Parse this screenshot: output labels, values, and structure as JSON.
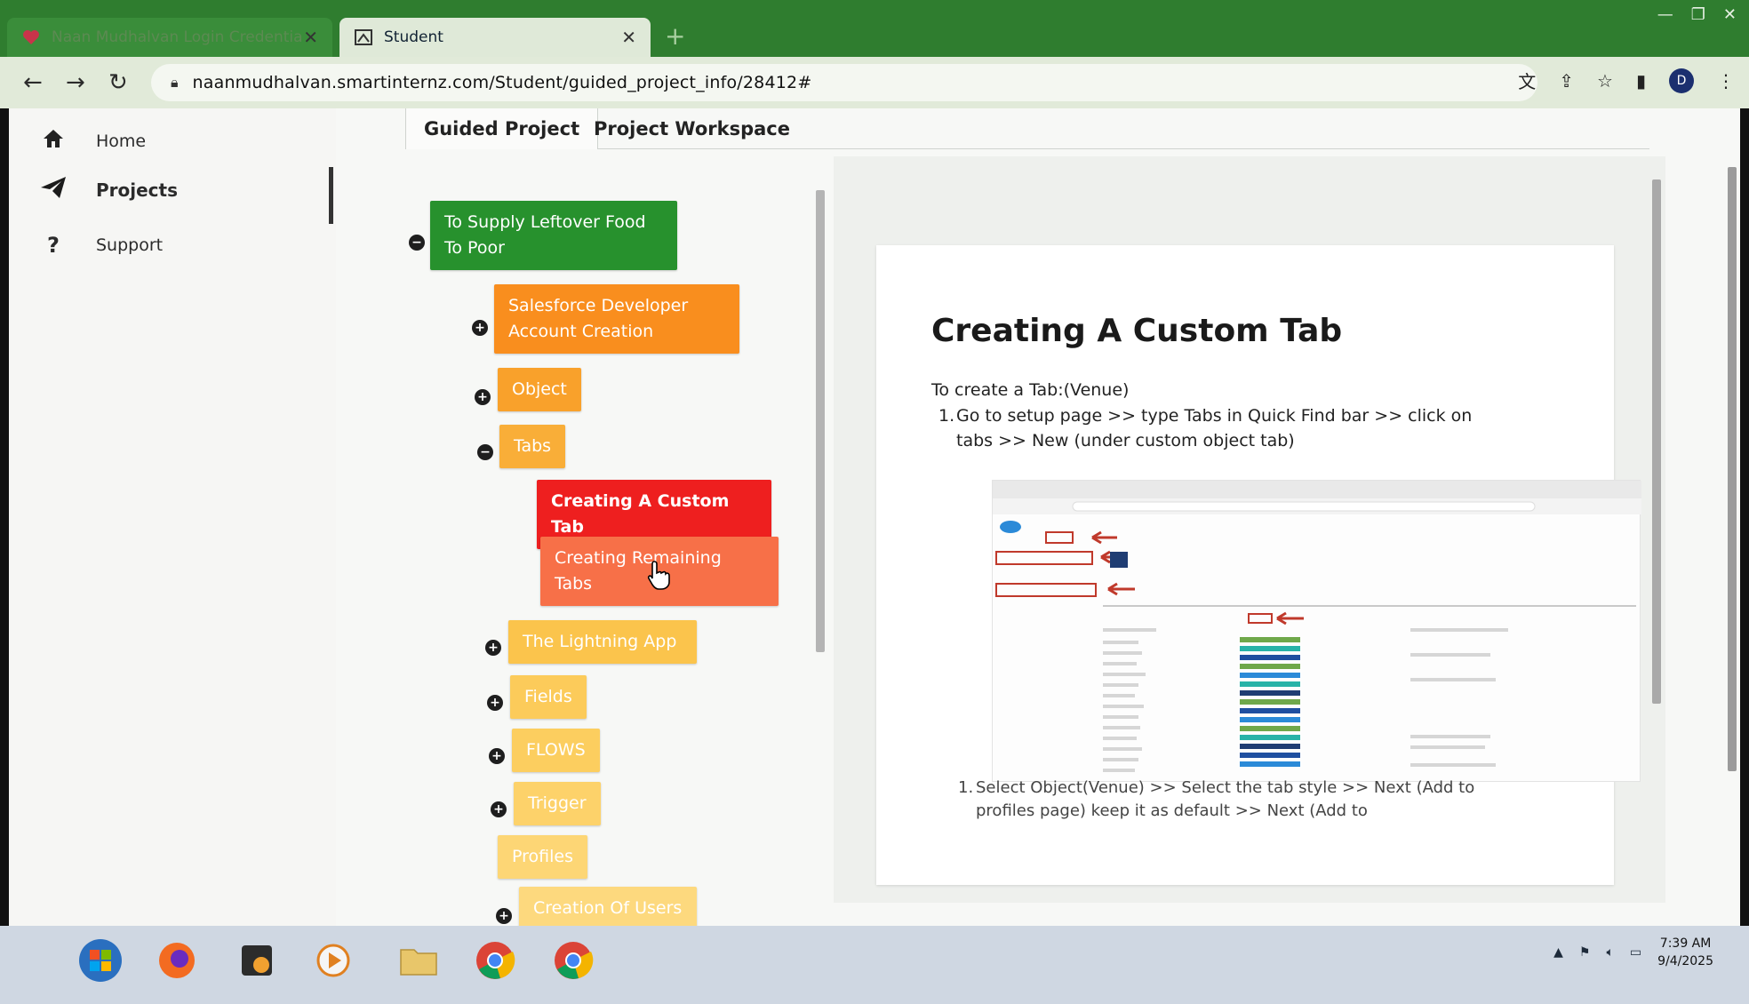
{
  "browser": {
    "tabs": [
      {
        "label": "Naan Mudhalvan Login Credentials - Pass",
        "active": false
      },
      {
        "label": "Student",
        "active": true
      }
    ],
    "url": "naanmudhalvan.smartinternz.com/Student/guided_project_info/28412#",
    "profile_initial": "D"
  },
  "sidebar": {
    "items": [
      {
        "label": "Home",
        "icon": "home-icon"
      },
      {
        "label": "Projects",
        "icon": "paper-plane-icon",
        "active": true
      },
      {
        "label": "Support",
        "icon": "question-icon"
      }
    ]
  },
  "page_tabs": {
    "guided": "Guided Project",
    "workspace": "Project Workspace"
  },
  "tree": {
    "root": {
      "line1": "To Supply Leftover Food",
      "line2": "To Poor",
      "color": "#27912d"
    },
    "n_salesforce": {
      "line1": "Salesforce Developer",
      "line2": "Account Creation",
      "color": "#f98e1e"
    },
    "n_object": {
      "label": "Object",
      "color": "#f9a12b"
    },
    "n_tabs": {
      "label": "Tabs",
      "color": "#f9ae38"
    },
    "n_custom_tab": {
      "label": "Creating A Custom Tab",
      "color": "#ee1f1f"
    },
    "n_remaining": {
      "line1": "Creating Remaining",
      "line2": "Tabs",
      "color": "#f77048"
    },
    "n_lightning": {
      "label": "The Lightning App",
      "color": "#fbc44c"
    },
    "n_fields": {
      "label": "Fields",
      "color": "#fccb5a"
    },
    "n_flows": {
      "label": "FLOWS",
      "color": "#fcce5f"
    },
    "n_trigger": {
      "label": "Trigger",
      "color": "#fdd26a"
    },
    "n_profiles": {
      "label": "Profiles",
      "color": "#fdd675"
    },
    "n_users": {
      "label": "Creation Of Users",
      "color": "#fdd97e"
    }
  },
  "content": {
    "title": "Creating A Custom Tab",
    "intro": "To create a Tab:(Venue)",
    "step1_num": "1.",
    "step1": "Go to setup page >> type Tabs in Quick Find bar >> click on tabs >> New (under custom object tab)",
    "step2_num": "1.",
    "step2": "Select Object(Venue) >> Select the tab style >> Next (Add to profiles page) keep it as default >> Next (Add to"
  },
  "taskbar": {
    "time": "7:39 AM",
    "date": "9/4/2025"
  }
}
